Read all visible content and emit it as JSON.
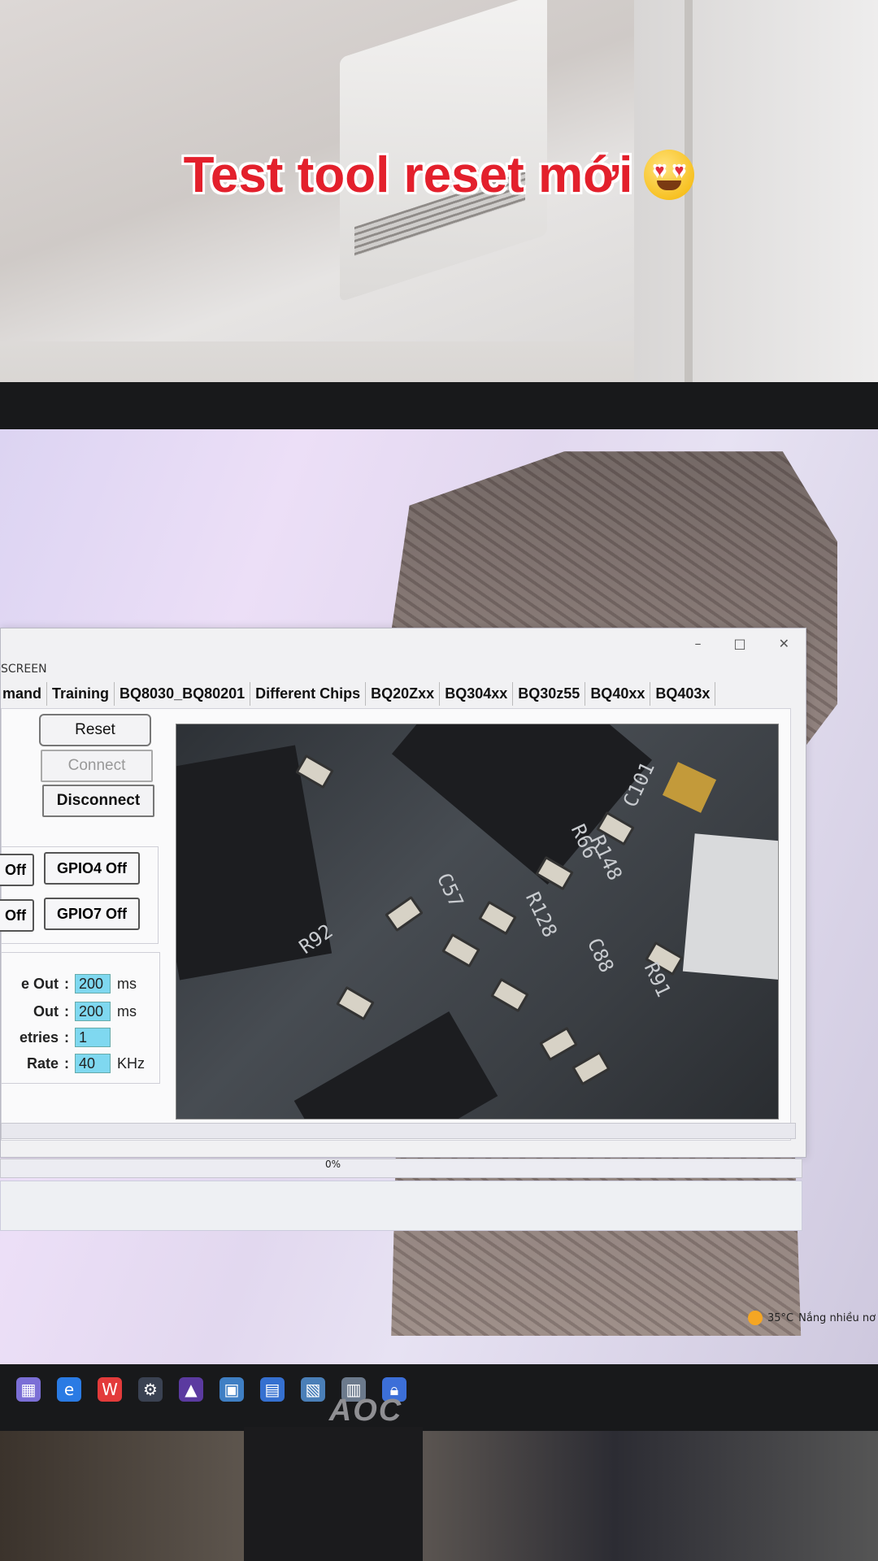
{
  "overlay_title": "Test tool reset mới",
  "emoji_icon": "heart-eyes-emoji",
  "window": {
    "title_partial": "SCREEN",
    "controls": {
      "minimize": "–",
      "maximize": "□",
      "close": "✕"
    },
    "tabs": [
      "mand",
      "Training",
      "BQ8030_BQ80201",
      "Different Chips",
      "BQ20Zxx",
      "BQ304xx",
      "BQ30z55",
      "BQ40xx",
      "BQ403x"
    ],
    "buttons": {
      "reset": "Reset",
      "connect": "Connect",
      "disconnect": "Disconnect"
    },
    "gpio": {
      "a_left": "Off",
      "a_right": "GPIO4 Off",
      "b_left": "Off",
      "b_right": "GPIO7 Off"
    },
    "config": [
      {
        "label": "e Out",
        "value": "200",
        "unit": "ms"
      },
      {
        "label": "Out",
        "value": "200",
        "unit": "ms"
      },
      {
        "label": "etries",
        "value": "1",
        "unit": ""
      },
      {
        "label": "Rate",
        "value": "40",
        "unit": "KHz"
      }
    ],
    "pcb_labels": [
      "C101",
      "R66",
      "R148",
      "R92",
      "C57",
      "R128",
      "C88",
      "R91"
    ],
    "progress": {
      "label": "0%",
      "fraction": 0
    }
  },
  "tray": {
    "weather": "35°C",
    "weather_text": "Nắng nhiều nơ"
  },
  "monitor_brand": "AOC",
  "colors": {
    "title_red": "#e3202c",
    "field_cyan": "#7fd8f0"
  }
}
